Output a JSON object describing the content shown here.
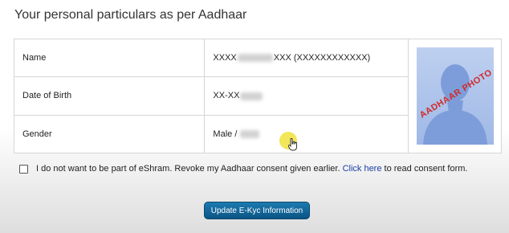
{
  "page": {
    "title": "Your personal particulars as per Aadhaar"
  },
  "details": {
    "rows": [
      {
        "label": "Name",
        "value_start": "XXXX",
        "value_end": "XXX (XXXXXXXXXXXX)"
      },
      {
        "label": "Date of Birth",
        "value_start": "XX-XX"
      },
      {
        "label": "Gender",
        "value_start": "Male / "
      }
    ]
  },
  "photo": {
    "stamp_text": "AADHAAR PHOTO",
    "stamp_color": "#d12a2a"
  },
  "consent": {
    "text_before_link": "I do not want to be part of eShram. Revoke my Aadhaar consent given earlier.",
    "link_text": "Click here",
    "text_after_link": "to read consent form.",
    "checked": false
  },
  "actions": {
    "update_label": "Update E-Kyc Information"
  },
  "colors": {
    "button": "#0a5484",
    "link": "#1a3fa6"
  }
}
